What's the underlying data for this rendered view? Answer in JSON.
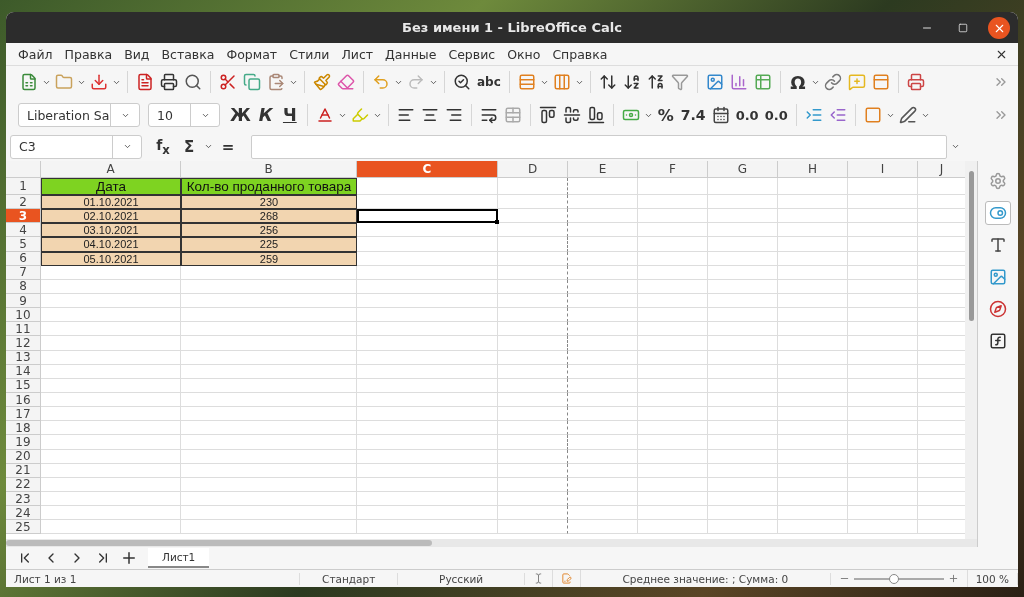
{
  "window": {
    "title": "Без имени 1 - LibreOffice Calc"
  },
  "menu": [
    "Файл",
    "Правка",
    "Вид",
    "Вставка",
    "Формат",
    "Стили",
    "Лист",
    "Данные",
    "Сервис",
    "Окно",
    "Справка"
  ],
  "standard_bar": {
    "spellcheck": "abc",
    "special_char": "Ω"
  },
  "format_bar": {
    "font": "Liberation Sa",
    "size": "10",
    "bold": "Ж",
    "italic": "К",
    "underline": "Ч",
    "percent": "%",
    "number": "7.4",
    "add_decimal": "0.0",
    "delete_decimal": "0.0"
  },
  "formula_bar": {
    "name_box": "C3",
    "function_wizard": "f$_{x}$",
    "sum": "Σ",
    "equals": "="
  },
  "sheet": {
    "columns": [
      {
        "label": "A",
        "selected": false
      },
      {
        "label": "B",
        "selected": false
      },
      {
        "label": "C",
        "selected": true
      },
      {
        "label": "D",
        "selected": false
      },
      {
        "label": "E",
        "selected": false
      },
      {
        "label": "F",
        "selected": false
      },
      {
        "label": "G",
        "selected": false
      },
      {
        "label": "H",
        "selected": false
      },
      {
        "label": "I",
        "selected": false
      },
      {
        "label": "J",
        "selected": false
      }
    ],
    "rows": [
      {
        "label": "1",
        "selected": false,
        "kind": "header",
        "cells": [
          "Дата",
          "Кол-во проданного товара"
        ]
      },
      {
        "label": "2",
        "selected": false,
        "kind": "data",
        "cells": [
          "01.10.2021",
          "230"
        ]
      },
      {
        "label": "3",
        "selected": true,
        "kind": "data",
        "cells": [
          "02.10.2021",
          "268"
        ]
      },
      {
        "label": "4",
        "selected": false,
        "kind": "data",
        "cells": [
          "03.10.2021",
          "256"
        ]
      },
      {
        "label": "5",
        "selected": false,
        "kind": "data",
        "cells": [
          "04.10.2021",
          "225"
        ]
      },
      {
        "label": "6",
        "selected": false,
        "kind": "data",
        "cells": [
          "05.10.2021",
          "259"
        ]
      },
      {
        "label": "7",
        "selected": false
      },
      {
        "label": "8",
        "selected": false
      },
      {
        "label": "9",
        "selected": false
      },
      {
        "label": "10",
        "selected": false
      },
      {
        "label": "11",
        "selected": false
      },
      {
        "label": "12",
        "selected": false
      },
      {
        "label": "13",
        "selected": false
      },
      {
        "label": "14",
        "selected": false
      },
      {
        "label": "15",
        "selected": false
      },
      {
        "label": "16",
        "selected": false
      },
      {
        "label": "17",
        "selected": false
      },
      {
        "label": "18",
        "selected": false
      },
      {
        "label": "19",
        "selected": false
      },
      {
        "label": "20",
        "selected": false
      },
      {
        "label": "21",
        "selected": false
      },
      {
        "label": "22",
        "selected": false
      },
      {
        "label": "23",
        "selected": false
      },
      {
        "label": "24",
        "selected": false
      },
      {
        "label": "25",
        "selected": false
      }
    ]
  },
  "sheet_tabs": [
    {
      "label": "Лист1",
      "selected": true
    }
  ],
  "status_bar": {
    "sheet": "Лист 1 из 1",
    "page_style": "Стандарт",
    "language": "Русский",
    "summary": "Среднее значение: ; Сумма: 0",
    "zoom": {
      "level": 0.45,
      "reading": "100 %"
    }
  }
}
